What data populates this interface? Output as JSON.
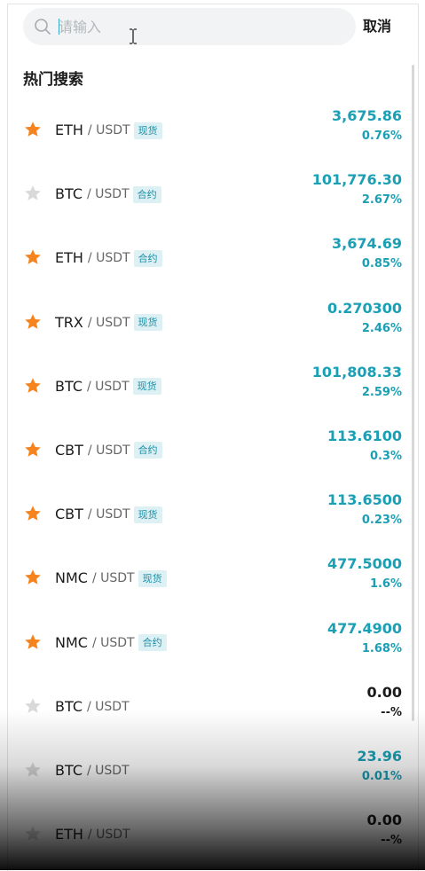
{
  "search": {
    "placeholder": "请输入",
    "cancel_label": "取消"
  },
  "section_title": "热门搜索",
  "colors": {
    "accent": "#1a9fb4",
    "star_active": "#f5841f",
    "star_inactive": "#d9d9d9",
    "tag_bg": "#ddf0f4"
  },
  "list": [
    {
      "base": "ETH",
      "quote": "/ USDT",
      "tag": "现货",
      "price": "3,675.86",
      "change": "0.76%",
      "favorite": true,
      "neutral": false
    },
    {
      "base": "BTC",
      "quote": "/ USDT",
      "tag": "合约",
      "price": "101,776.30",
      "change": "2.67%",
      "favorite": false,
      "neutral": false
    },
    {
      "base": "ETH",
      "quote": "/ USDT",
      "tag": "合约",
      "price": "3,674.69",
      "change": "0.85%",
      "favorite": true,
      "neutral": false
    },
    {
      "base": "TRX",
      "quote": "/ USDT",
      "tag": "现货",
      "price": "0.270300",
      "change": "2.46%",
      "favorite": true,
      "neutral": false
    },
    {
      "base": "BTC",
      "quote": "/ USDT",
      "tag": "现货",
      "price": "101,808.33",
      "change": "2.59%",
      "favorite": true,
      "neutral": false
    },
    {
      "base": "CBT",
      "quote": "/ USDT",
      "tag": "合约",
      "price": "113.6100",
      "change": "0.3%",
      "favorite": true,
      "neutral": false
    },
    {
      "base": "CBT",
      "quote": "/ USDT",
      "tag": "现货",
      "price": "113.6500",
      "change": "0.23%",
      "favorite": true,
      "neutral": false
    },
    {
      "base": "NMC",
      "quote": "/ USDT",
      "tag": "现货",
      "price": "477.5000",
      "change": "1.6%",
      "favorite": true,
      "neutral": false
    },
    {
      "base": "NMC",
      "quote": "/ USDT",
      "tag": "合约",
      "price": "477.4900",
      "change": "1.68%",
      "favorite": true,
      "neutral": false
    },
    {
      "base": "BTC",
      "quote": "/ USDT",
      "tag": "",
      "price": "0.00",
      "change": "--%",
      "favorite": false,
      "neutral": true
    },
    {
      "base": "BTC",
      "quote": "/ USDT",
      "tag": "",
      "price": "23.96",
      "change": "0.01%",
      "favorite": false,
      "neutral": false
    },
    {
      "base": "ETH",
      "quote": "/ USDT",
      "tag": "",
      "price": "0.00",
      "change": "--%",
      "favorite": false,
      "neutral": true
    }
  ]
}
